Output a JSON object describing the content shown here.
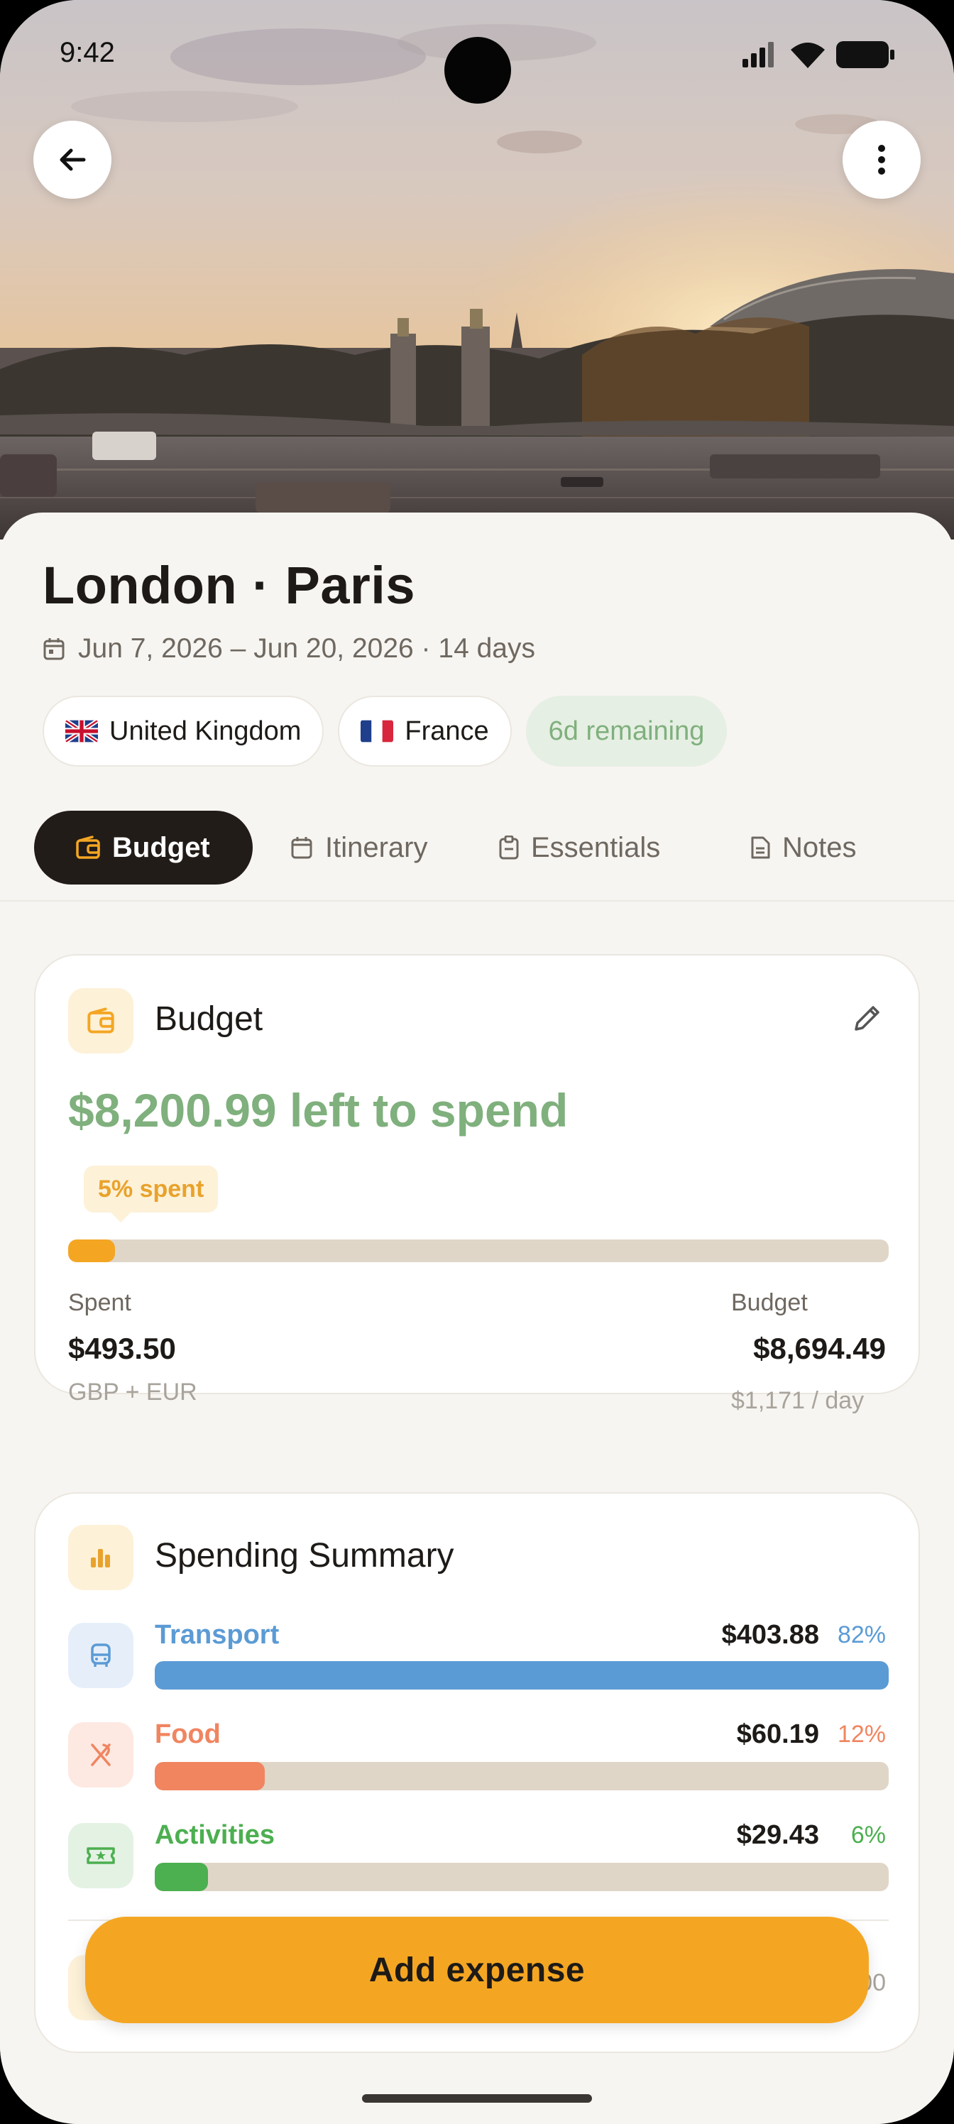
{
  "status_bar": {
    "time": "9:42"
  },
  "trip": {
    "title": "London · Paris",
    "dates": "Jun 7, 2026 – Jun 20, 2026 · 14 days",
    "chips": [
      {
        "label": "United Kingdom",
        "flag": "uk-flag-icon"
      },
      {
        "label": "France",
        "flag": "france-flag-icon"
      },
      {
        "label": "6d remaining"
      }
    ]
  },
  "tabs": [
    {
      "label": "Budget",
      "icon": "wallet-icon",
      "active": true
    },
    {
      "label": "Itinerary",
      "icon": "calendar-icon"
    },
    {
      "label": "Essentials",
      "icon": "clipboard-icon"
    },
    {
      "label": "Notes",
      "icon": "document-icon"
    }
  ],
  "budget": {
    "title": "Budget",
    "left_to_spend": "$8,200.99 left to spend",
    "spent_pill": "5% spent",
    "spent_fraction": 0.057,
    "spent_label": "Spent",
    "spent_value": "$493.50",
    "spent_currencies": "GBP + EUR",
    "budget_label": "Budget",
    "budget_value": "$8,694.49",
    "per_day": "$1,171 / day"
  },
  "summary": {
    "title": "Spending Summary",
    "categories": [
      {
        "name": "Transport",
        "amount": "$403.88",
        "percent": "82%",
        "fraction": 1.0,
        "color": "#5b9bd5",
        "icon": "bus-icon",
        "icon_bg": "#e6eff9"
      },
      {
        "name": "Food",
        "amount": "$60.19",
        "percent": "12%",
        "fraction": 0.15,
        "color": "#f08560",
        "icon": "utensils-icon",
        "icon_bg": "#fde9e2"
      },
      {
        "name": "Activities",
        "amount": "$29.43",
        "percent": "6%",
        "fraction": 0.073,
        "color": "#4caf50",
        "icon": "ticket-icon",
        "icon_bg": "#e4f2e4"
      }
    ],
    "peek_amount": "00"
  },
  "actions": {
    "add_expense": "Add expense"
  },
  "colors": {
    "accent": "#f4a623",
    "positive": "#7fb07d",
    "dark": "#221c19"
  }
}
